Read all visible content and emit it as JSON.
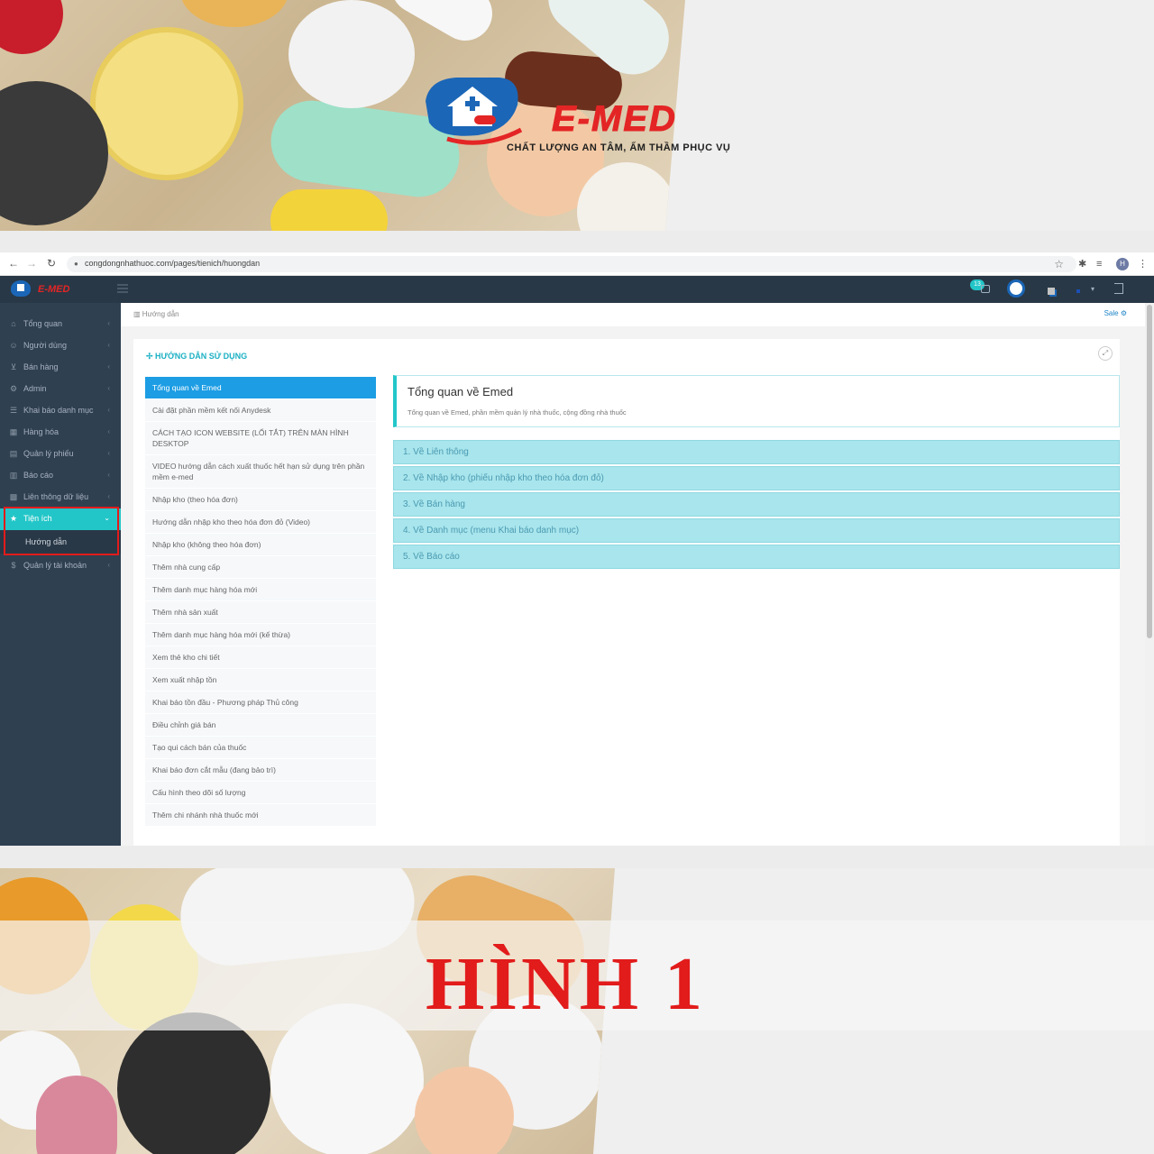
{
  "brand": {
    "name": "E-MED",
    "tagline": "CHẤT LƯỢNG AN TÂM, ẤM THẦM PHỤC VỤ",
    "colors": {
      "red": "#e42525",
      "blue": "#1b66b7",
      "teal": "#23c6c8"
    }
  },
  "browser": {
    "url": "congdongnhathuoc.com/pages/tienich/huongdan",
    "profile_initial": "H"
  },
  "header": {
    "logo_text": "E-MED",
    "notification_count": "13"
  },
  "sidebar": {
    "items": [
      {
        "label": "Tổng quan",
        "icon": "home-icon",
        "glyph": "⌂"
      },
      {
        "label": "Người dùng",
        "icon": "user-icon",
        "glyph": "☺"
      },
      {
        "label": "Bán hàng",
        "icon": "cart-icon",
        "glyph": "🛒"
      },
      {
        "label": "Admin",
        "icon": "gear-icon",
        "glyph": "⚙"
      },
      {
        "label": "Khai báo danh mục",
        "icon": "list-icon",
        "glyph": "☰"
      },
      {
        "label": "Hàng hóa",
        "icon": "truck-icon",
        "glyph": "▦"
      },
      {
        "label": "Quản lý phiếu",
        "icon": "file-icon",
        "glyph": "▤"
      },
      {
        "label": "Báo cáo",
        "icon": "bar-chart-icon",
        "glyph": "▥"
      },
      {
        "label": "Liên thông dữ liệu",
        "icon": "bank-icon",
        "glyph": "▩"
      },
      {
        "label": "Tiện ích",
        "icon": "star-icon",
        "glyph": "★",
        "active": true
      },
      {
        "label": "Quản lý tài khoản",
        "icon": "dollar-icon",
        "glyph": "$"
      }
    ],
    "sub_item": "Hướng dẫn"
  },
  "breadcrumb": "Hướng dẫn",
  "sale_label": "Sale",
  "panel": {
    "title": "HƯỚNG DẪN SỬ DỤNG"
  },
  "guide_items": [
    "Tổng quan về Emed",
    "Cài đặt phần mềm kết nối Anydesk",
    "CÁCH TẠO ICON WEBSITE (LỐI TẮT) TRÊN MÀN HÌNH DESKTOP",
    "VIDEO hướng dẫn cách xuất thuốc hết hạn sử dụng trên phần mềm e-med",
    "Nhập kho (theo hóa đơn)",
    "Hướng dẫn nhập kho theo hóa đơn đỏ (Video)",
    "Nhập kho (không theo hóa đơn)",
    "Thêm nhà cung cấp",
    "Thêm danh mục hàng hóa mới",
    "Thêm nhà sản xuất",
    "Thêm danh mục hàng hóa mới (kế thừa)",
    "Xem thẻ kho chi tiết",
    "Xem xuất nhập tồn",
    "Khai báo tồn đầu - Phương pháp Thủ công",
    "Điều chỉnh giá bán",
    "Tạo qui cách bán của thuốc",
    "Khai báo đơn cắt mẫu (đang bảo trì)",
    "Cấu hình theo dõi số lượng",
    "Thêm chi nhánh nhà thuốc mới"
  ],
  "detail": {
    "title": "Tổng quan về Emed",
    "subtitle": "Tổng quan về Emed, phần mềm quản lý nhà thuốc, cộng đồng nhà thuốc",
    "sections": [
      "1. Về Liên thông",
      "2. Về Nhập kho (phiếu nhập kho theo hóa đơn đỏ)",
      "3. Về Bán hàng",
      "4. Về Danh mục (menu Khai báo danh mục)",
      "5. Về Báo cáo"
    ]
  },
  "caption": "HÌNH 1"
}
